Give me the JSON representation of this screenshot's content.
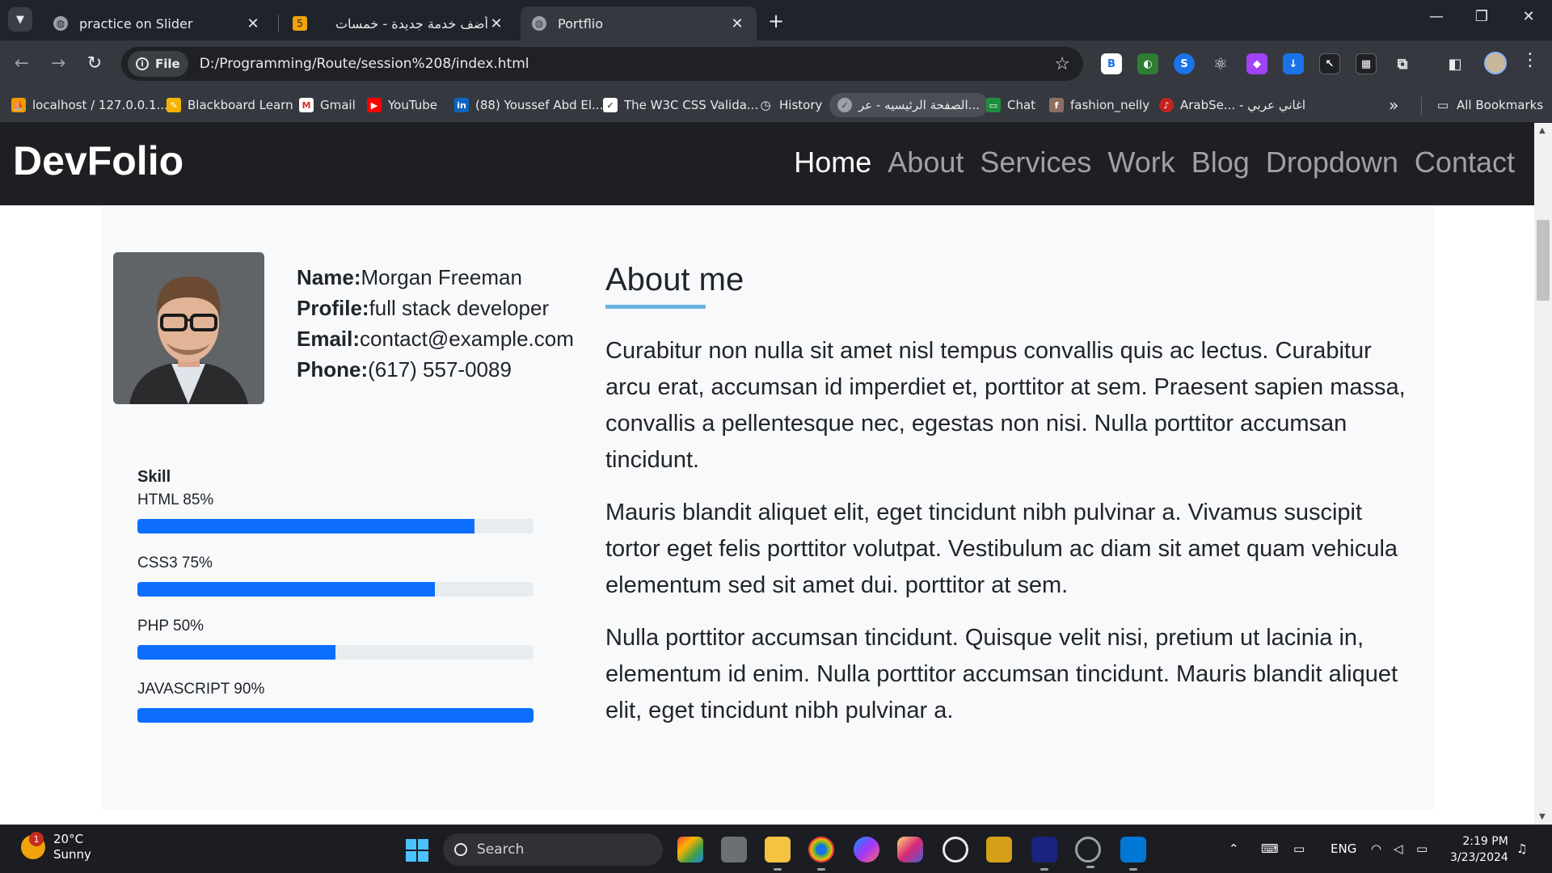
{
  "browser": {
    "tabs": [
      {
        "title": "practice on Slider",
        "active": false
      },
      {
        "title": "أضف خدمة جديدة - خمسات",
        "active": false
      },
      {
        "title": "Portflio",
        "active": true
      }
    ],
    "address": {
      "chip": "File",
      "url": "D:/Programming/Route/session%208/index.html"
    },
    "bookmarks": [
      {
        "label": "localhost / 127.0.0.1..."
      },
      {
        "label": "Blackboard Learn"
      },
      {
        "label": "Gmail"
      },
      {
        "label": "YouTube"
      },
      {
        "label": "(88) Youssef Abd El..."
      },
      {
        "label": "The W3C CSS Valida..."
      },
      {
        "label": "History"
      },
      {
        "label": "الصفحة الرئيسيه - عر..."
      },
      {
        "label": "Chat"
      },
      {
        "label": "fashion_nelly"
      },
      {
        "label": "ArabSe... - اغاني عربي"
      }
    ],
    "all_bookmarks": "All Bookmarks"
  },
  "site": {
    "brand": "DevFolio",
    "menu": [
      "Home",
      "About",
      "Services",
      "Work",
      "Blog",
      "Dropdown",
      "Contact"
    ],
    "profile": {
      "name_label": "Name:",
      "name": "Morgan Freeman",
      "profile_label": "Profile:",
      "profile": "full stack developer",
      "email_label": "Email:",
      "email": "contact@example.com",
      "phone_label": "Phone:",
      "phone": "(617) 557-0089"
    },
    "skills_title": "Skill",
    "skills": [
      {
        "label": "HTML 85%",
        "level": 85
      },
      {
        "label": "CSS3 75%",
        "level": 75
      },
      {
        "label": "PHP 50%",
        "level": 50
      },
      {
        "label": "JAVASCRIPT 90%",
        "level": 100
      }
    ],
    "about_title": "About me",
    "paragraphs": [
      "Curabitur non nulla sit amet nisl tempus convallis quis ac lectus. Curabitur arcu erat, accumsan id imperdiet et, porttitor at sem. Praesent sapien massa, convallis a pellentesque nec, egestas non nisi. Nulla porttitor accumsan tincidunt.",
      "Mauris blandit aliquet elit, eget tincidunt nibh pulvinar a. Vivamus suscipit tortor eget felis porttitor volutpat. Vestibulum ac diam sit amet quam vehicula elementum sed sit amet dui. porttitor at sem.",
      "Nulla porttitor accumsan tincidunt. Quisque velit nisi, pretium ut lacinia in, elementum id enim. Nulla porttitor accumsan tincidunt. Mauris blandit aliquet elit, eget tincidunt nibh pulvinar a."
    ]
  },
  "taskbar": {
    "weather_badge": "1",
    "temperature": "20°C",
    "condition": "Sunny",
    "search": "Search",
    "language": "ENG",
    "time": "2:19 PM",
    "date": "3/23/2024"
  },
  "colors": {
    "accent": "#0d6efd",
    "underline": "#6ab5e0",
    "nav_bg": "#1e1f22"
  }
}
